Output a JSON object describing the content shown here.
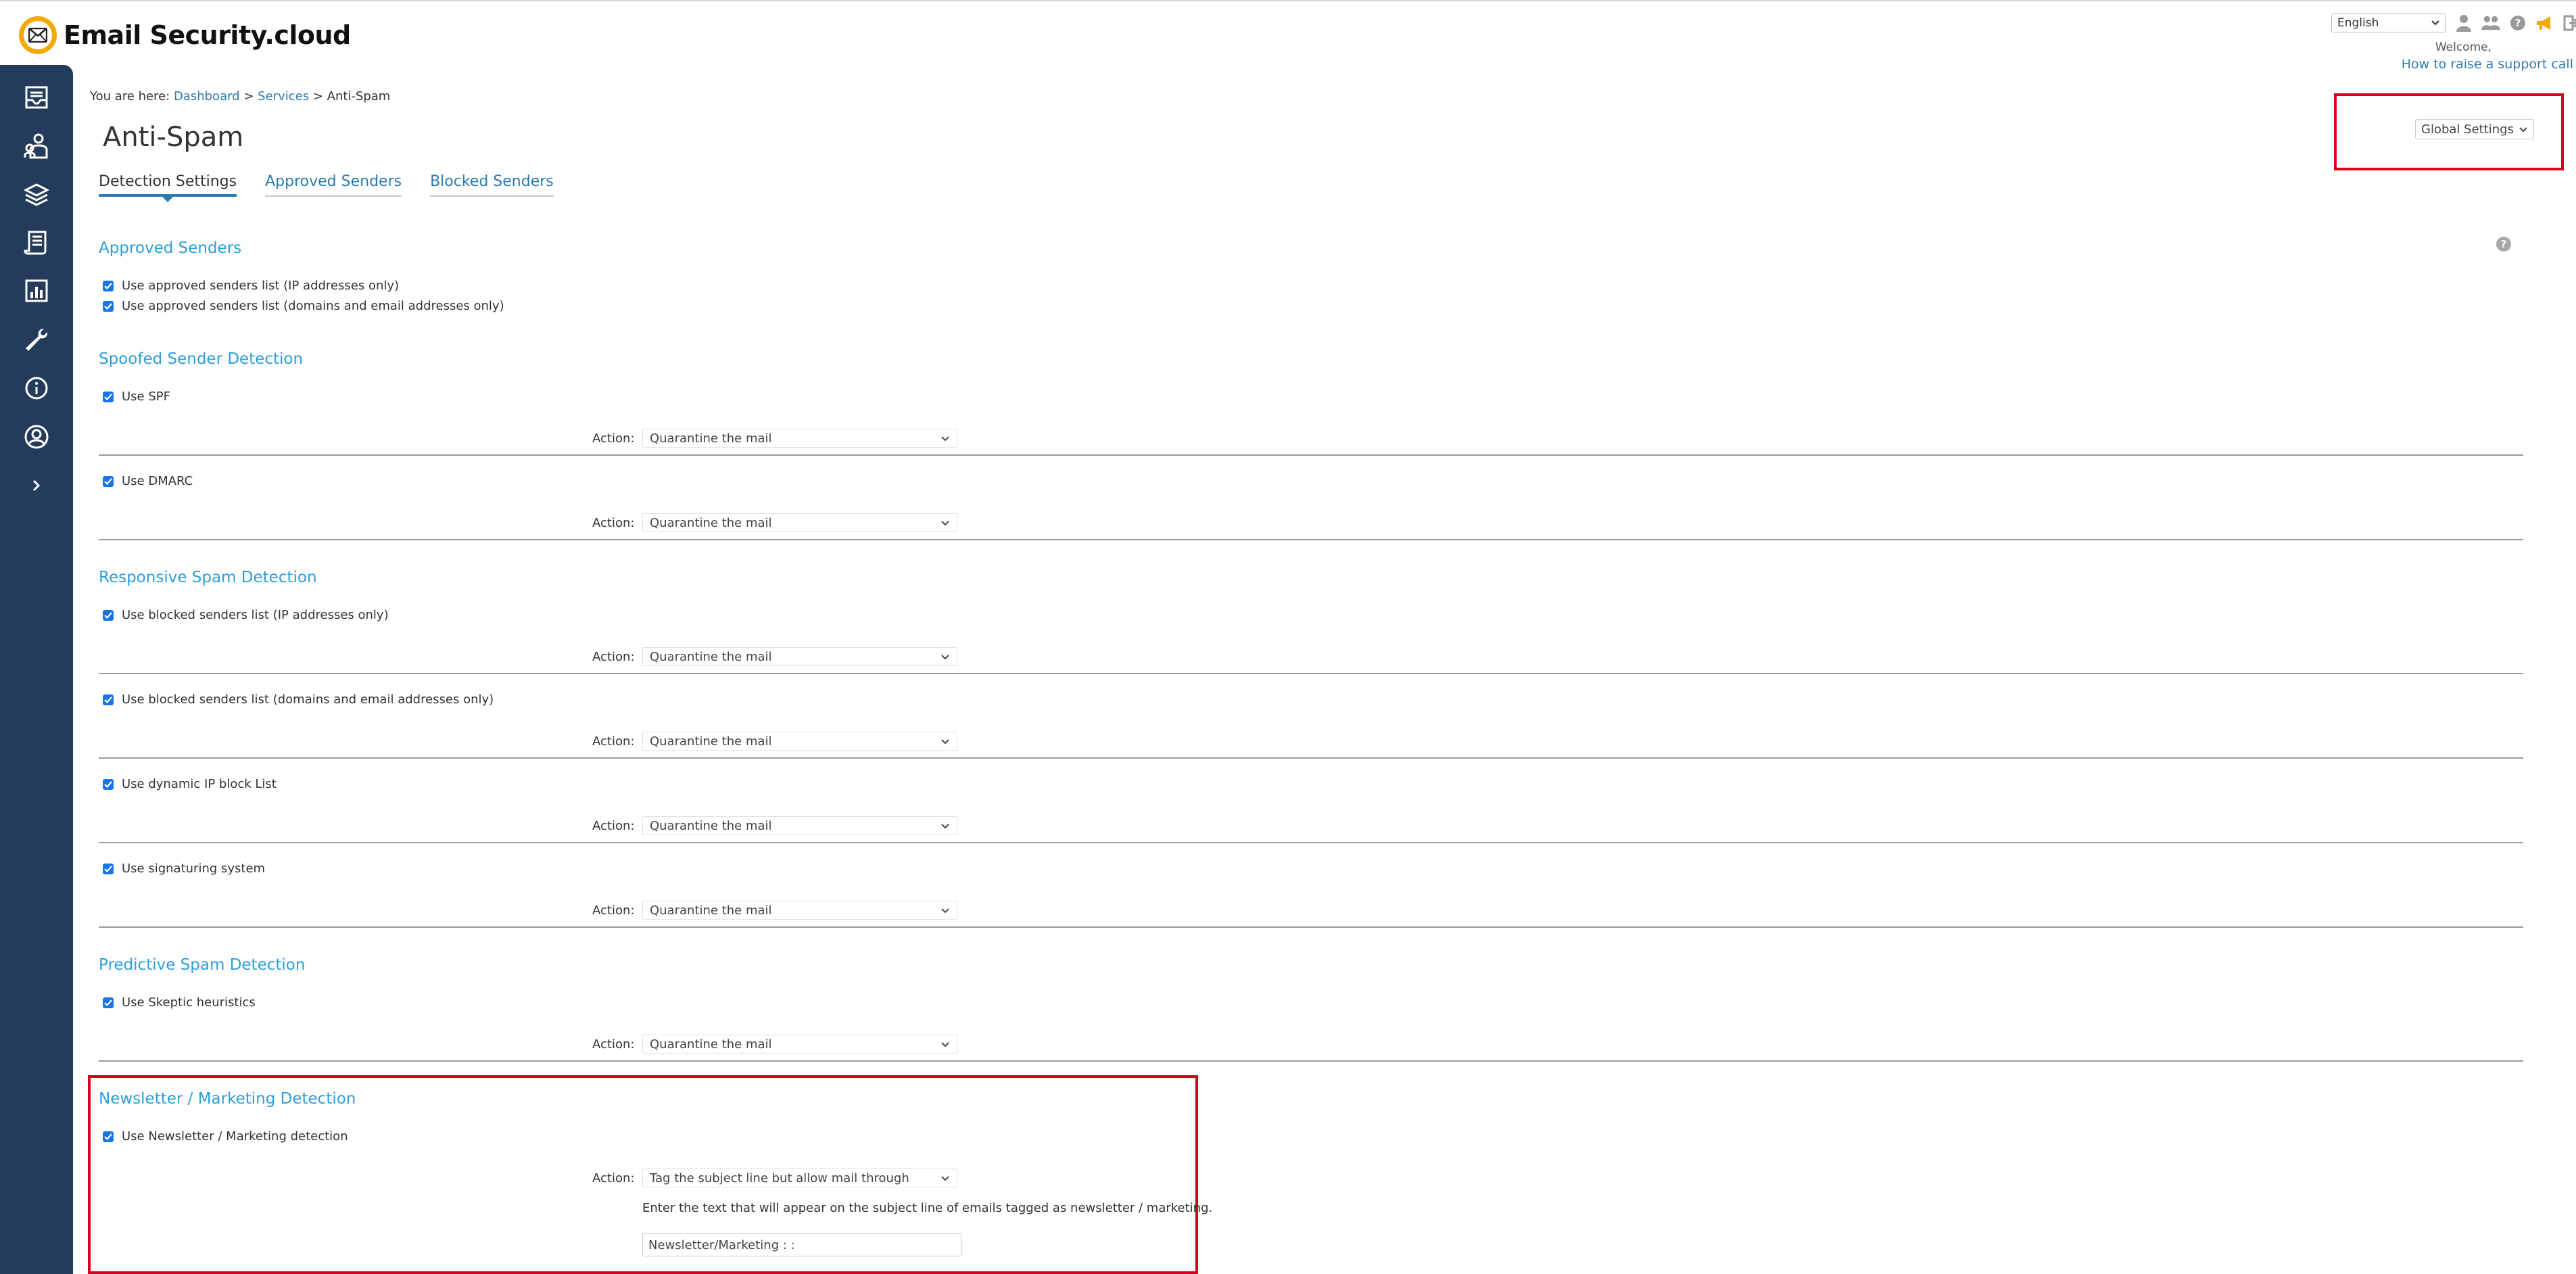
{
  "app": {
    "logo_text": "Email Security.cloud",
    "language": "English",
    "welcome": "Welcome,",
    "support_link": "How to raise a support call"
  },
  "breadcrumb": {
    "prefix": "You are here:",
    "items": [
      "Dashboard",
      "Services",
      "Anti-Spam"
    ],
    "separator": ">"
  },
  "page": {
    "title": "Anti-Spam",
    "global_settings": "Global Settings"
  },
  "tabs": [
    {
      "label": "Detection Settings",
      "active": true
    },
    {
      "label": "Approved Senders",
      "active": false
    },
    {
      "label": "Blocked Senders",
      "active": false
    }
  ],
  "action_label": "Action:",
  "sections": {
    "approved": {
      "title": "Approved Senders",
      "items": [
        "Use approved senders list (IP addresses only)",
        "Use approved senders list (domains and email addresses only)"
      ]
    },
    "spoofed": {
      "title": "Spoofed Sender Detection",
      "items": [
        {
          "label": "Use SPF",
          "action": "Quarantine the mail"
        },
        {
          "label": "Use DMARC",
          "action": "Quarantine the mail"
        }
      ]
    },
    "responsive": {
      "title": "Responsive Spam Detection",
      "items": [
        {
          "label": "Use blocked senders list (IP addresses only)",
          "action": "Quarantine the mail"
        },
        {
          "label": "Use blocked senders list (domains and email addresses only)",
          "action": "Quarantine the mail"
        },
        {
          "label": "Use dynamic IP block List",
          "action": "Quarantine the mail"
        },
        {
          "label": "Use signaturing system",
          "action": "Quarantine the mail"
        }
      ]
    },
    "predictive": {
      "title": "Predictive Spam Detection",
      "items": [
        {
          "label": "Use Skeptic heuristics",
          "action": "Quarantine the mail"
        }
      ]
    },
    "newsletter": {
      "title": "Newsletter / Marketing Detection",
      "item": {
        "label": "Use Newsletter / Marketing detection",
        "action": "Tag the subject line but allow mail through"
      },
      "help_text": "Enter the text that will appear on the subject line of emails tagged as newsletter / marketing.",
      "subject_tag": "Newsletter/Marketing : :"
    }
  },
  "colors": {
    "sidebar": "#243b5b",
    "link": "#2b7bb0",
    "section_title": "#2b9fd9",
    "highlight": "#d9001b",
    "logo": "#f2a900"
  },
  "icons": {
    "sidebar": [
      "dashboard-icon",
      "users-icon",
      "services-icon",
      "reports-icon",
      "chart-icon",
      "tools-icon",
      "info-icon",
      "account-icon",
      "expand-icon"
    ],
    "top": [
      "user-icon",
      "group-icon",
      "help-icon",
      "announce-icon",
      "logout-icon"
    ]
  }
}
